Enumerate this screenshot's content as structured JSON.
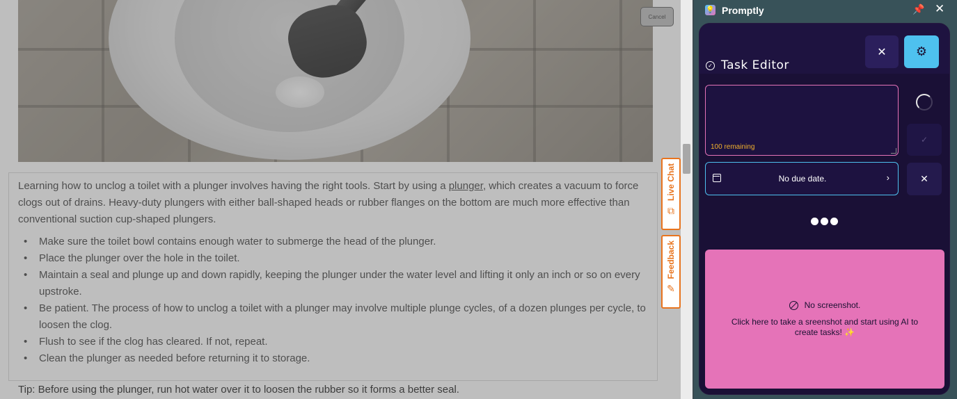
{
  "article": {
    "cancel_label": "Cancel",
    "intro_before_link": "Learning how to unclog a toilet with a plunger involves having the right tools. Start by using a ",
    "intro_link": "plunger",
    "intro_after_link": ", which creates a vacuum to force clogs out of drains. Heavy-duty plungers with either ball-shaped heads or rubber flanges on the bottom are much more effective than conventional suction cup-shaped plungers.",
    "steps": [
      "Make sure the toilet bowl contains enough water to submerge the head of the plunger.",
      "Place the plunger over the hole in the toilet.",
      "Maintain a seal and plunge up and down rapidly, keeping the plunger under the water level and lifting it only an inch or so on every upstroke.",
      "Be patient. The process of how to unclog a toilet with a plunger may involve multiple plunge cycles, of a dozen plunges per cycle, to loosen the clog.",
      "Flush to see if the clog has cleared. If not, repeat.",
      "Clean the plunger as needed before returning it to storage."
    ],
    "tip": "Tip: Before using the plunger, run hot water over it to loosen the rubber so it forms a better seal."
  },
  "side_tabs": {
    "live_chat": "Live Chat",
    "feedback": "Feedback"
  },
  "panel": {
    "app_title": "Promptly",
    "editor_title": "Task Editor",
    "task_input_value": "",
    "remaining_text": "100 remaining",
    "due_date_text": "No due date.",
    "no_screenshot_text": "No screenshot.",
    "screenshot_hint": "Click here to take a sreenshot and start using AI to create tasks! ✨"
  },
  "icons": {
    "pin": "pin-icon",
    "close": "close-icon",
    "settings": "gear-icon",
    "check": "check-icon",
    "calendar": "calendar-icon",
    "chevron": "chevron-right-icon",
    "no_screenshot": "ban-icon"
  },
  "colors": {
    "panel_bg": "#385259",
    "card_bg": "#1b1132",
    "accent_pink": "#e573b8",
    "accent_blue": "#4ec1ef",
    "warning_text": "#f2b12e",
    "tab_orange": "#e8741e"
  }
}
